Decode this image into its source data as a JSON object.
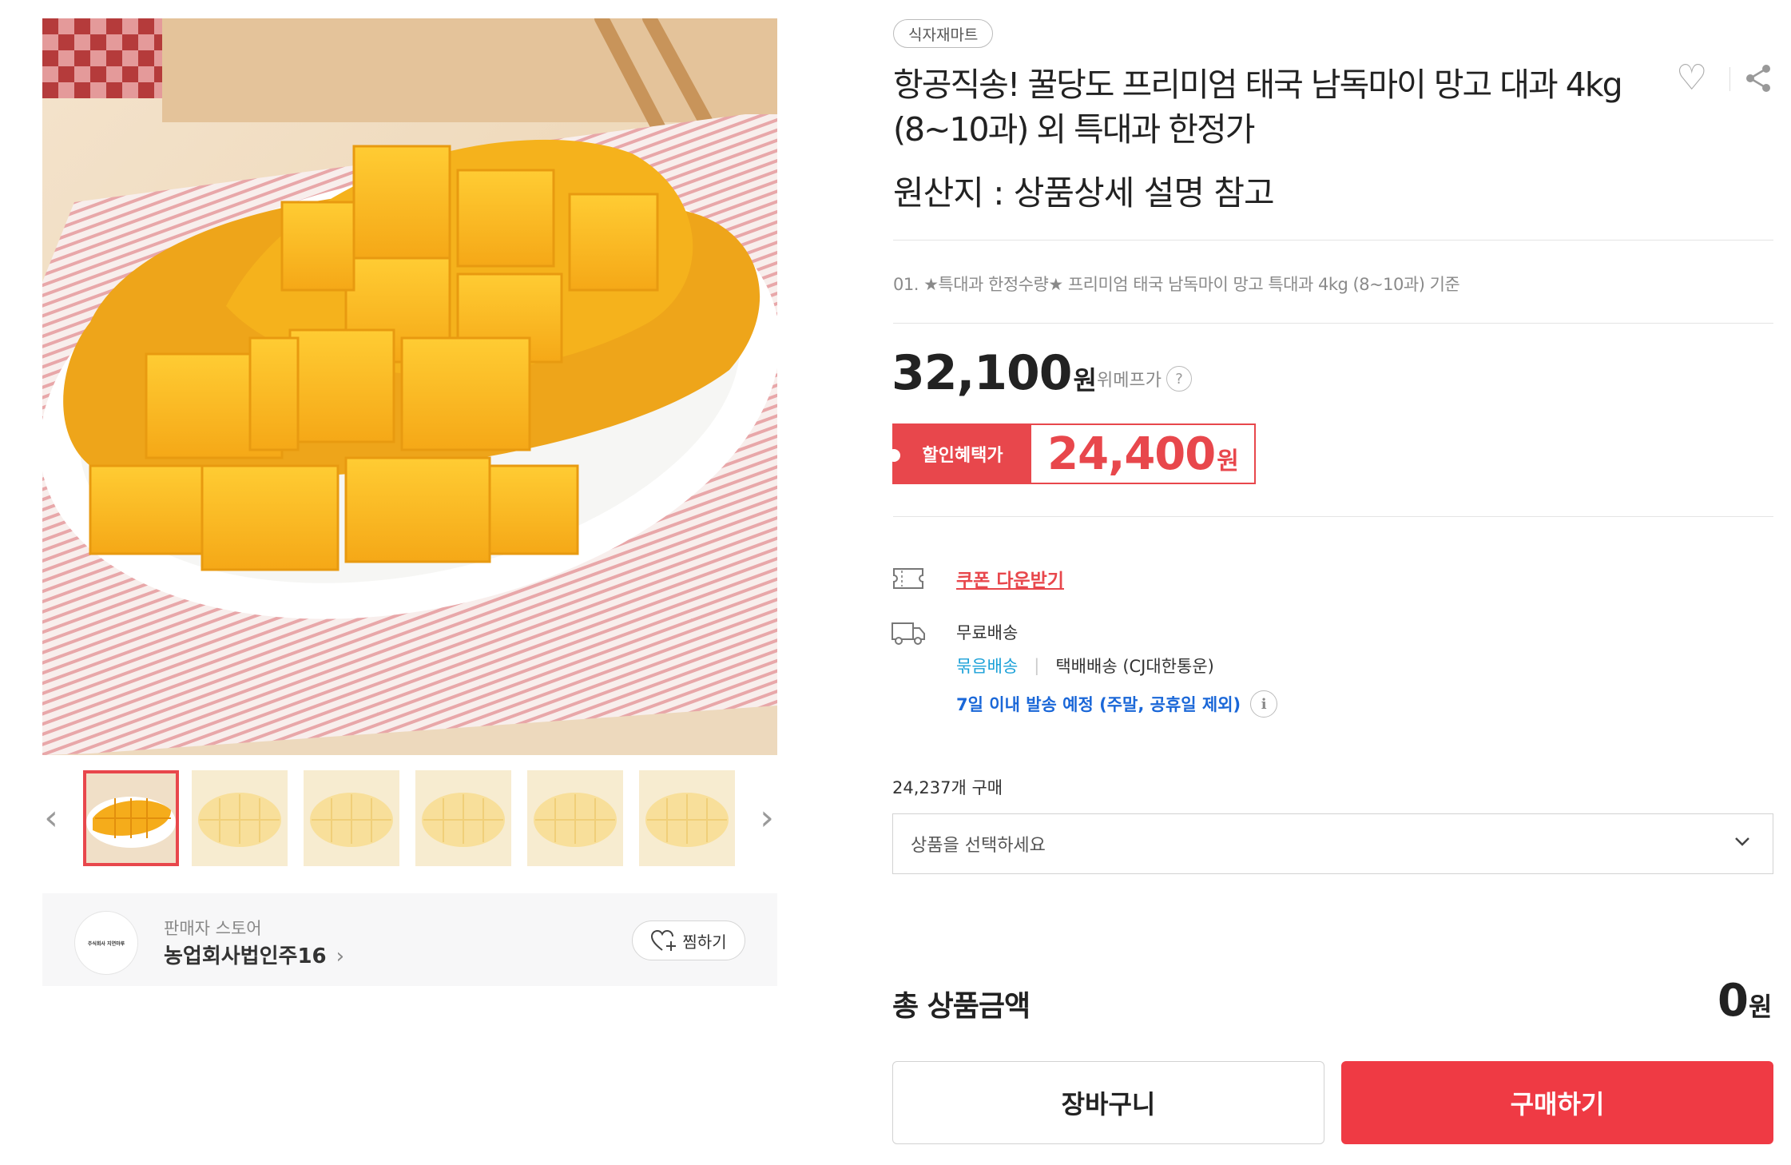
{
  "gallery": {
    "prev_icon": "chevron-left-icon",
    "next_icon": "chevron-right-icon",
    "thumbnail_count": 6,
    "active_thumbnail": 0
  },
  "seller": {
    "logo_text": "주식회사 지연마루",
    "label": "판매자 스토어",
    "name": "농업회사법인주16",
    "name_chevron": "›",
    "wish_label": "찜하기"
  },
  "product": {
    "category": "식자재마트",
    "title": "항공직송! 꿀당도 프리미엄 태국 남독마이 망고 대과 4kg (8~10과) 외 특대과 한정가",
    "origin": "원산지 : 상품상세 설명 참고",
    "option_desc": "01. ★특대과 한정수량★ 프리미엄 태국 남독마이 망고 특대과 4kg (8~10과) 기준"
  },
  "price": {
    "value": "32,100",
    "unit": "원",
    "label": "위메프가",
    "help": "?",
    "discount_label": "할인혜택가",
    "discount_value": "24,400",
    "discount_unit": "원"
  },
  "benefits": {
    "coupon_label": "쿠폰 다운받기"
  },
  "shipping": {
    "free": "무료배송",
    "bundle": "묶음배송",
    "separator": "|",
    "courier": "택배배송 (CJ대한통운)",
    "eta": "7일 이내 발송 예정 (주말, 공휴일 제외)",
    "info": "i"
  },
  "purchase": {
    "count": "24,237개 구매",
    "select_placeholder": "상품을 선택하세요",
    "total_label": "총 상품금액",
    "total_value": "0",
    "total_unit": "원",
    "cart_label": "장바구니",
    "buy_label": "구매하기"
  },
  "colors": {
    "accent_red": "#e8474c",
    "buy_red": "#ef3a44",
    "link_blue": "#1a67d8",
    "bundle_blue": "#1aa0d8",
    "mango_yellow": "#f7b21a"
  }
}
